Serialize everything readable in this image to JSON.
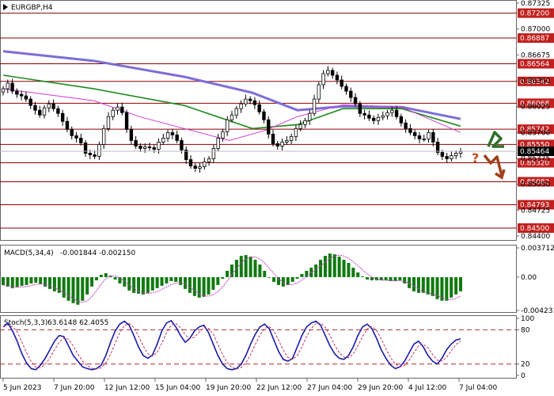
{
  "chart_data": [
    {
      "type": "candlestick",
      "title": "EURGBP,H4",
      "symbol": "EURGBP",
      "timeframe": "H4",
      "ylim": [
        0.844,
        0.87325
      ],
      "y_ticks": [
        "0.87325",
        "0.87000",
        "0.86675",
        "0.86350",
        "0.86025",
        "0.85700",
        "0.85375",
        "0.85050",
        "0.84725",
        "0.84400"
      ],
      "levels": [
        {
          "label": "0.87200",
          "value": 0.872
        },
        {
          "label": "0.86887",
          "value": 0.86887
        },
        {
          "label": "0.86564",
          "value": 0.86564
        },
        {
          "label": "0.86342",
          "value": 0.86342
        },
        {
          "label": "0.86068",
          "value": 0.86068
        },
        {
          "label": "0.85742",
          "value": 0.85742
        },
        {
          "label": "0.85550",
          "value": 0.8555
        },
        {
          "label": "0.85320",
          "value": 0.8532
        },
        {
          "label": "0.85082",
          "value": 0.85082
        },
        {
          "label": "0.84793",
          "value": 0.84793
        },
        {
          "label": "0.84500",
          "value": 0.845
        }
      ],
      "current_price": {
        "label": "0.85464",
        "value": 0.85464
      },
      "close_series": [
        0.8625,
        0.8632,
        0.8622,
        0.8618,
        0.8616,
        0.8612,
        0.8604,
        0.8598,
        0.8592,
        0.8601,
        0.8606,
        0.86,
        0.8594,
        0.8584,
        0.8574,
        0.8566,
        0.8563,
        0.8557,
        0.8544,
        0.8542,
        0.854,
        0.8555,
        0.8575,
        0.859,
        0.8598,
        0.8602,
        0.8595,
        0.8574,
        0.856,
        0.8553,
        0.855,
        0.8552,
        0.8551,
        0.8549,
        0.8558,
        0.8563,
        0.857,
        0.8567,
        0.856,
        0.8548,
        0.8536,
        0.8528,
        0.8525,
        0.8527,
        0.8533,
        0.8537,
        0.855,
        0.8563,
        0.8571,
        0.8586,
        0.8592,
        0.86,
        0.8606,
        0.8612,
        0.861,
        0.8605,
        0.8596,
        0.8586,
        0.8568,
        0.8556,
        0.8553,
        0.8558,
        0.856,
        0.8565,
        0.8575,
        0.858,
        0.8585,
        0.8594,
        0.8612,
        0.863,
        0.8644,
        0.8648,
        0.8642,
        0.8636,
        0.8628,
        0.8622,
        0.8614,
        0.8606,
        0.8594,
        0.8592,
        0.8588,
        0.8585,
        0.8589,
        0.8591,
        0.8595,
        0.8598,
        0.859,
        0.8582,
        0.8575,
        0.857,
        0.8566,
        0.8562,
        0.8562,
        0.857,
        0.8558,
        0.8545,
        0.854,
        0.8537,
        0.8541,
        0.8544,
        0.8546
      ],
      "moving_averages": [
        {
          "name": "slow MA",
          "color": "#7b6fd6",
          "points": [
            [
              0,
              0.8672
            ],
            [
              20,
              0.866
            ],
            [
              40,
              0.864
            ],
            [
              55,
              0.862
            ],
            [
              65,
              0.8598
            ],
            [
              75,
              0.8603
            ],
            [
              88,
              0.8602
            ],
            [
              101,
              0.8587
            ]
          ]
        },
        {
          "name": "mid MA",
          "color": "#1f8a1f",
          "points": [
            [
              0,
              0.8642
            ],
            [
              20,
              0.8625
            ],
            [
              40,
              0.8604
            ],
            [
              55,
              0.8575
            ],
            [
              65,
              0.858
            ],
            [
              75,
              0.86
            ],
            [
              88,
              0.86
            ],
            [
              101,
              0.8578
            ]
          ]
        },
        {
          "name": "fast MA",
          "color": "#d23ad2",
          "points": [
            [
              0,
              0.8625
            ],
            [
              20,
              0.861
            ],
            [
              30,
              0.859
            ],
            [
              40,
              0.8575
            ],
            [
              50,
              0.856
            ],
            [
              58,
              0.8573
            ],
            [
              65,
              0.859
            ],
            [
              75,
              0.8605
            ],
            [
              88,
              0.8602
            ],
            [
              101,
              0.857
            ]
          ]
        }
      ],
      "scenario_marker": "?",
      "x_ticks": [
        "5 Jun 2023",
        "7 Jun 20:00",
        "12 Jun 12:00",
        "15 Jun 04:00",
        "19 Jun 20:00",
        "22 Jun 12:00",
        "27 Jun 04:00",
        "29 Jun 20:00",
        "4 Jul 12:00",
        "7 Jul 04:00"
      ],
      "colors": {
        "level": "#8b0000",
        "label_bg": "#c0201e",
        "up_arrow": "#2f6f2f",
        "down_arrow": "#a0401e",
        "candle": "#000000"
      }
    },
    {
      "type": "histogram",
      "title": "MACD(5,34,4)",
      "name": "MACD(5,34,4)",
      "values_label": "-0.001844 -0.002150",
      "ylim": [
        -0.004231,
        0.003712
      ],
      "y_ticks": [
        "0.003712",
        "0.00",
        "-0.004231"
      ],
      "histogram": [
        -0.001,
        -0.0012,
        -0.0014,
        -0.0013,
        -0.0011,
        -0.001,
        -0.0008,
        -0.0007,
        -0.0009,
        -0.0012,
        -0.0015,
        -0.0018,
        -0.002,
        -0.0026,
        -0.003,
        -0.0033,
        -0.0035,
        -0.003,
        -0.0022,
        -0.0012,
        -0.0004,
        0.0003,
        0.0005,
        0.0002,
        -0.0003,
        -0.0008,
        -0.0012,
        -0.0017,
        -0.002,
        -0.0021,
        -0.0022,
        -0.002,
        -0.0017,
        -0.0014,
        -0.0011,
        -0.0008,
        -0.0005,
        -0.0006,
        -0.001,
        -0.0015,
        -0.002,
        -0.0024,
        -0.0026,
        -0.0025,
        -0.0022,
        -0.0016,
        -0.001,
        -0.0002,
        0.0008,
        0.0016,
        0.0022,
        0.0027,
        0.0028,
        0.0026,
        0.0022,
        0.0016,
        0.0008,
        0.0,
        -0.0006,
        -0.001,
        -0.0012,
        -0.001,
        -0.0006,
        -0.0002,
        0.0004,
        0.0008,
        0.0012,
        0.0016,
        0.0022,
        0.0027,
        0.003,
        0.0029,
        0.0026,
        0.0022,
        0.0018,
        0.0012,
        0.0006,
        0.0001,
        -0.0003,
        -0.0004,
        -0.0004,
        -0.0004,
        -0.0004,
        -0.0005,
        -0.0005,
        -0.0004,
        -0.0008,
        -0.0014,
        -0.0018,
        -0.002,
        -0.002,
        -0.0022,
        -0.0024,
        -0.0028,
        -0.003,
        -0.003,
        -0.0026,
        -0.0022,
        -0.0018
      ],
      "signal_color": "#c040c0",
      "bar_color": "#0f7a0f"
    },
    {
      "type": "line",
      "title": "Stoch(5,3,3)",
      "name": "Stoch(5,3,3)",
      "values_label": "63.6148 62.4055",
      "ylim": [
        0,
        100
      ],
      "y_ticks": [
        "100",
        "80",
        "20",
        "0"
      ],
      "main_line": [
        85,
        92,
        78,
        60,
        38,
        22,
        12,
        10,
        18,
        30,
        45,
        60,
        70,
        68,
        52,
        35,
        25,
        15,
        12,
        10,
        12,
        18,
        35,
        58,
        78,
        90,
        95,
        88,
        70,
        50,
        35,
        30,
        36,
        55,
        78,
        92,
        96,
        85,
        70,
        58,
        65,
        78,
        85,
        88,
        75,
        55,
        35,
        20,
        12,
        10,
        12,
        20,
        35,
        55,
        72,
        85,
        90,
        82,
        62,
        42,
        28,
        25,
        30,
        50,
        70,
        85,
        92,
        95,
        88,
        70,
        52,
        38,
        30,
        28,
        35,
        50,
        70,
        85,
        90,
        82,
        65,
        45,
        30,
        18,
        12,
        15,
        25,
        40,
        55,
        60,
        50,
        35,
        25,
        20,
        30,
        45,
        55,
        62,
        64
      ],
      "line_color": "#1a1aaa",
      "signal_color": "#c03060"
    }
  ]
}
